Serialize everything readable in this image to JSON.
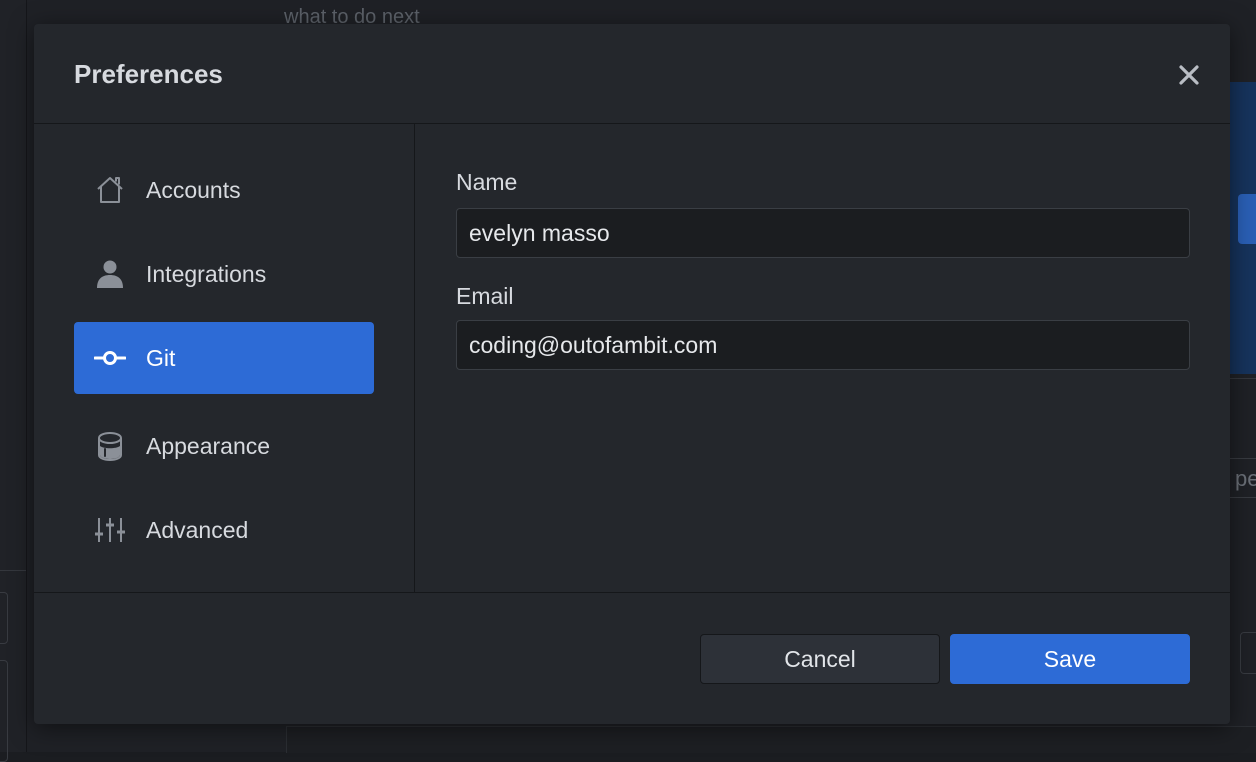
{
  "background": {
    "top_text": "what to do next",
    "right_chip_text": "pe"
  },
  "dialog": {
    "title": "Preferences",
    "close_icon": "close-icon"
  },
  "sidebar": {
    "items": [
      {
        "label": "Accounts",
        "icon": "home-icon",
        "active": false
      },
      {
        "label": "Integrations",
        "icon": "person-icon",
        "active": false
      },
      {
        "label": "Git",
        "icon": "git-commit-icon",
        "active": true
      },
      {
        "label": "Appearance",
        "icon": "paintcan-icon",
        "active": false
      },
      {
        "label": "Advanced",
        "icon": "settings-sliders-icon",
        "active": false
      }
    ]
  },
  "git": {
    "name_label": "Name",
    "name_value": "evelyn masso",
    "email_label": "Email",
    "email_value": "coding@outofambit.com"
  },
  "footer": {
    "cancel_label": "Cancel",
    "save_label": "Save"
  },
  "colors": {
    "accent": "#2d6bd6",
    "dialog_bg": "#24272c",
    "input_bg": "#1b1d20",
    "text": "#d7dadf"
  }
}
